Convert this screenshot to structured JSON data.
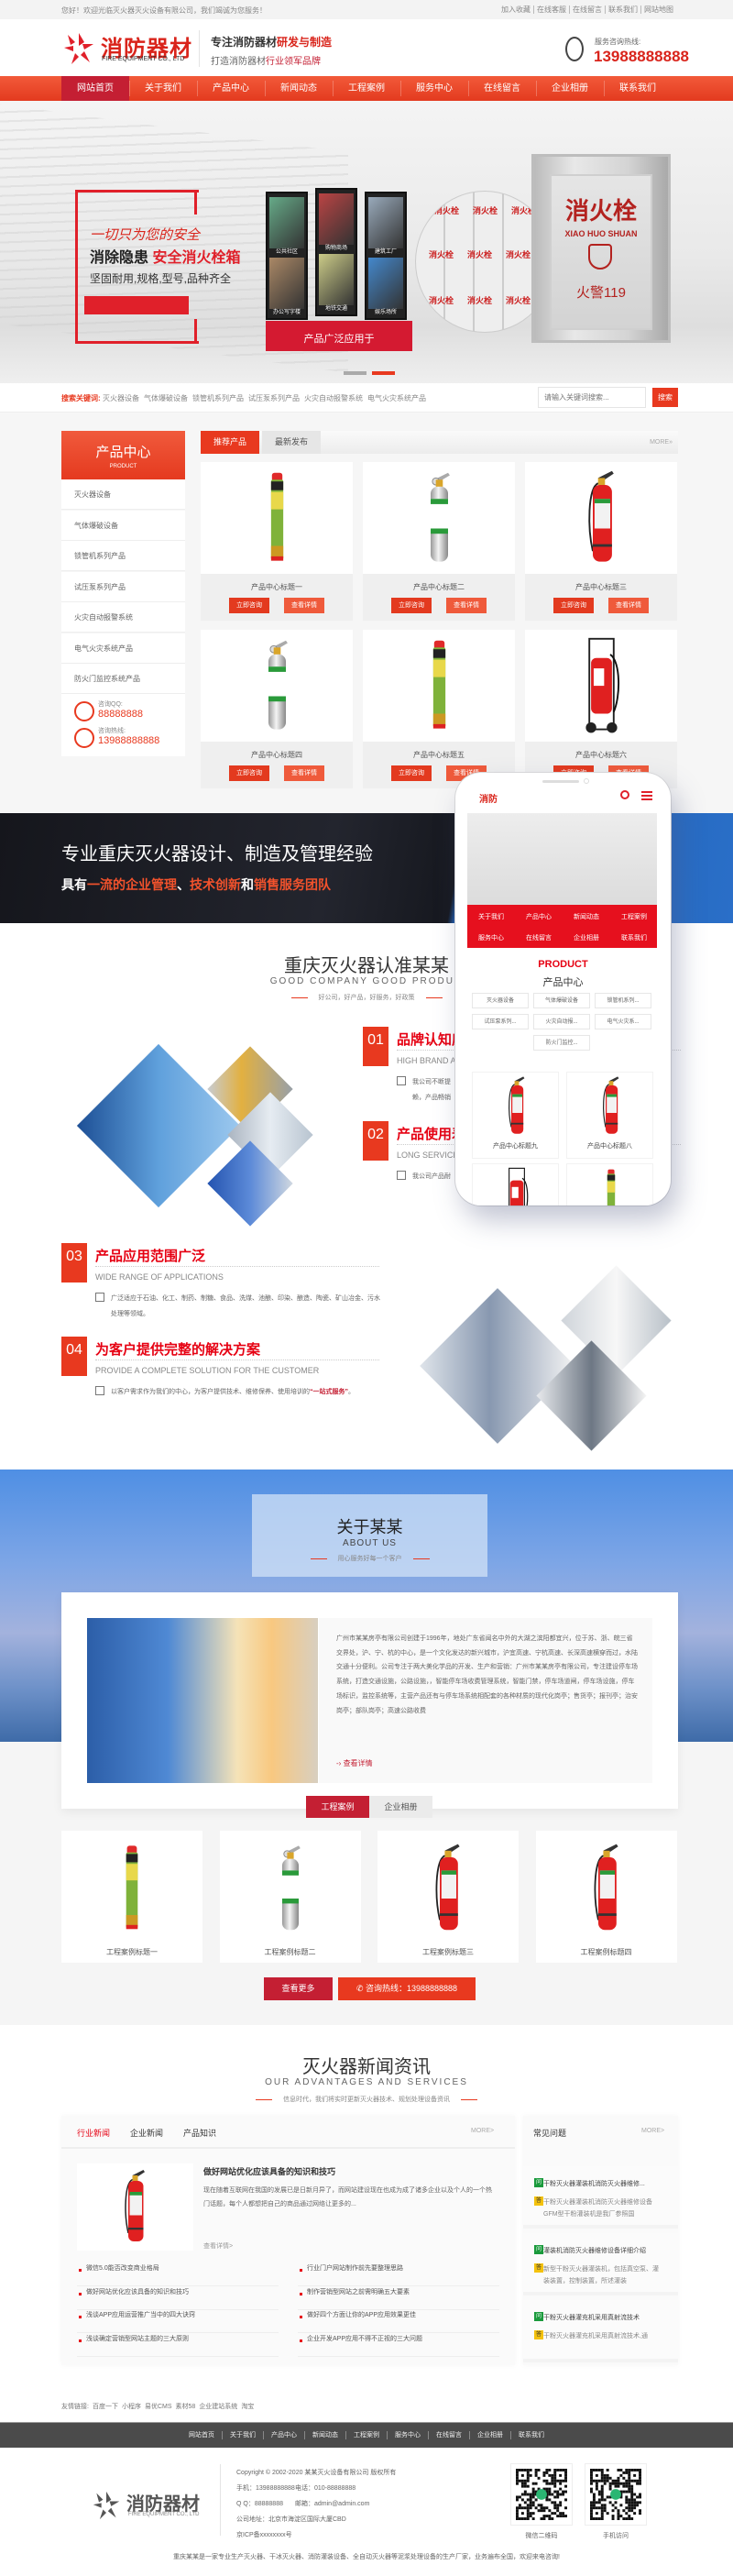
{
  "topbar": {
    "welcome": "您好！欢迎光临灭火器灭火设备有限公司，我们竭诚为您服务！",
    "links": [
      "加入收藏",
      "在线客服",
      "在线留言",
      "联系我们",
      "网站地图"
    ]
  },
  "header": {
    "logo_cn": "消防器材",
    "logo_en": "FIRE EQUIPMENT CO., LTD",
    "slogan_a": "专注消防器材",
    "slogan_b": "研发与制造",
    "tag_a": "打造消防器材",
    "tag_b": "行业领军品牌",
    "hotline_label": "服务咨询热线:",
    "hotline": "13988888888"
  },
  "nav": {
    "items": [
      "网站首页",
      "关于我们",
      "产品中心",
      "新闻动态",
      "工程案例",
      "服务中心",
      "在线留言",
      "企业相册",
      "联系我们"
    ],
    "active": 0
  },
  "hero": {
    "script": "一切只为您的安全",
    "line1a": "消除隐患",
    "line1b": "安全消火栓箱",
    "line2": "坚固耐用,规格,型号,品种齐全",
    "apply": "产品广泛应用于",
    "scenes": [
      "公共社区",
      "购物商场",
      "建筑工厂",
      "办公写字楼",
      "地铁交通",
      "娱乐场所"
    ],
    "box_cn": "消火栓",
    "box_en": "XIAO HUO SHUAN",
    "box_119": "火警119",
    "slides": 2,
    "active_slide": 1
  },
  "search": {
    "label": "搜索关键词:",
    "keywords": [
      "灭火器设备",
      "气体爆破设备",
      "锁管机系列产品",
      "试压泵系列产品",
      "火灾自动报警系统",
      "电气火灾系统产品"
    ],
    "placeholder": "请输入关键词搜索...",
    "button": "搜索"
  },
  "products": {
    "sidebar": {
      "title": "产品中心",
      "subtitle": "PRODUCT",
      "categories": [
        "灭火器设备",
        "气体爆破设备",
        "锁管机系列产品",
        "试压泵系列产品",
        "火灾自动报警系统",
        "电气火灾系统产品",
        "防火门监控系统产品"
      ],
      "qq_label": "咨询QQ:",
      "qq": "88888888",
      "tel_label": "咨询热线:",
      "tel": "13988888888"
    },
    "tabs": [
      "推荐产品",
      "最新发布"
    ],
    "active_tab": 0,
    "more": "MORE»",
    "consult": "立即咨询",
    "detail": "查看详情",
    "items": [
      {
        "title": "产品中心标题一",
        "image": "spray-can"
      },
      {
        "title": "产品中心标题二",
        "image": "silver-extinguisher"
      },
      {
        "title": "产品中心标题三",
        "image": "red-extinguisher"
      },
      {
        "title": "产品中心标题四",
        "image": "silver-extinguisher"
      },
      {
        "title": "产品中心标题五",
        "image": "spray-can"
      },
      {
        "title": "产品中心标题六",
        "image": "cart-extinguisher"
      }
    ]
  },
  "banner": {
    "title": "专业重庆灭火器设计、制造及管理经验",
    "sub": [
      {
        "text": "具有",
        "highlight": false
      },
      {
        "text": "一流的企业管理",
        "highlight": true
      },
      {
        "text": "、",
        "highlight": false
      },
      {
        "text": "技术创新",
        "highlight": true
      },
      {
        "text": "和",
        "highlight": false
      },
      {
        "text": "销售服务团队",
        "highlight": true
      }
    ]
  },
  "advantages": {
    "title": "重庆灭火器认准某某",
    "en": "GOOD COMPANY GOOD PRODUC",
    "sub": "好公司，好产品，好服务，好政策",
    "items": [
      {
        "num": "01",
        "title": "品牌认知度",
        "en": "HIGH BRAND A",
        "text": "我公司不断提",
        "text2": "赖，产品畅销"
      },
      {
        "num": "02",
        "title": "产品使用寿",
        "en": "LONG SERVICE",
        "text": "我公司产品耐"
      },
      {
        "num": "03",
        "title": "产品应用范围广泛",
        "en": "WIDE RANGE OF APPLICATIONS",
        "text": "广泛适应于石油、化工、制药、制糖、食品、洗煤、池酿、印染、酿造、陶瓷、矿山冶金、污水处理等领域。"
      },
      {
        "num": "04",
        "title": "为客户提供完整的解决方案",
        "en": "PROVIDE A COMPLETE SOLUTION FOR THE CUSTOMER",
        "text": "以客户需求作为我们的中心，为客户提供技术、维修保养、使用培训的",
        "highlight": "“一站式服务”",
        "tail": "。"
      }
    ]
  },
  "phone": {
    "logo": "消防",
    "nav": [
      "关于我们",
      "产品中心",
      "新闻动态",
      "工程案例",
      "服务中心",
      "在线留言",
      "企业相册",
      "联系我们"
    ],
    "product_en": "PRODUCT",
    "product_cn": "产品中心",
    "chips": [
      "灭火器设备",
      "气体爆破设备",
      "锁管机系列...",
      "试压泵系列...",
      "火灾自动报...",
      "电气火灾系...",
      "防火门监控..."
    ],
    "items": [
      "产品中心标题九",
      "产品中心标题八"
    ]
  },
  "about": {
    "title": "关于某某",
    "en": "ABOUT US",
    "sub": "用心服务好每一个客户",
    "text": "广州市某某房亭有限公司创建于1996年，地处广东省闻名中外的大湖之滨阳都宜兴，位于苏、浙、皖三省交界处，沪、宁、杭的中心，是一个文化发达的新兴城市，沪宜高速、宁杭高速、长深高速横穿而过，水陆交通十分便利。公司专注于两大美化学品的开发、生产和营销：广州市某某房亭有限公司，专注建设停车场系统，打造交通设施，公路设施，，智能停车场收费管理系统，智能门禁，停车场道闸，停车场设施，停车场标识，监控系统等，主营产品还有与停车场系统相配套的各种材质的现代化岗亭；售货亭；报刊亭；治安岗亭；部队岗亭；高速公路收费",
    "more": "查看详情"
  },
  "cases": {
    "tabs": [
      "工程案例",
      "企业相册"
    ],
    "active_tab": 0,
    "items": [
      {
        "title": "工程案例标题一",
        "image": "spray-can"
      },
      {
        "title": "工程案例标题二",
        "image": "silver-extinguisher"
      },
      {
        "title": "工程案例标题三",
        "image": "red-extinguisher"
      },
      {
        "title": "工程案例标题四",
        "image": "red-extinguisher"
      }
    ],
    "more": "查看更多",
    "hotline": "咨询热线：13988888888"
  },
  "news": {
    "title": "灭火器新闻资讯",
    "en": "OUR ADVANTAGES AND SERVICES",
    "sub": "信息时代，我们将实时更新灭火器技术、规划处理设备资讯",
    "tabs": [
      "行业新闻",
      "企业新闻",
      "产品知识"
    ],
    "active_tab": 0,
    "more": "MORE>",
    "featured": {
      "title": "做好网站优化应该具备的知识和技巧",
      "desc": "现在随着互联网在我国的发展已是日新月异了，而网站建设现在也成为成了诸多企业以及个人的一个热门话题，每个人都想把自己的商品通过网络让更多的...",
      "more": "查看详情>"
    },
    "list_left": [
      "微信5.0能否改变商业格局",
      "做好网站优化应该具备的知识和技巧",
      "浅谈APP应用运营推广当中的四大诀窍",
      "浅谈确定营销型网站主题的三大原则"
    ],
    "list_right": [
      "行业门户网站制作前先要整理思路",
      "制作营销型网站之前需明确五大要素",
      "做好四个方面让你的APP应用效果更佳",
      "企业开发APP应用不得不正视的三大问题"
    ],
    "faq": {
      "title": "常见问题",
      "more": "MORE>",
      "q_icon": "问",
      "a_icon": "答",
      "items": [
        {
          "q": "干粉灭火器灌装机消防灭火器维修...",
          "a": "干粉灭火器灌装机消防灭火器维修设备 GFM型干粉灌装机是我厂参照国"
        },
        {
          "q": "灌装机消防灭火器维修设备详细介绍",
          "a": "新型干粉灭火器灌装机，包括真空泵、灌装装置，控制装置，所述灌装"
        },
        {
          "q": "干粉灭火器灌充机采用真射流技术",
          "a": "干粉灭火器灌充机采用真射流技术,通"
        }
      ]
    }
  },
  "friend_links": {
    "label": "友情链接:",
    "links": [
      "百度一下",
      "小程序",
      "易优CMS",
      "素材58",
      "企业建站系统",
      "淘宝"
    ]
  },
  "footer": {
    "nav": [
      "网站首页",
      "关于我们",
      "产品中心",
      "新闻动态",
      "工程案例",
      "服务中心",
      "在线留言",
      "企业相册",
      "联系我们"
    ],
    "logo_cn": "消防器材",
    "logo_en": "FIRE EQUIPMENT CO., LTD",
    "copyright": "Copyright © 2002-2020 某某灭火设备有限公司 版权所有",
    "mobile": "手机：13988888888",
    "phone": "电话：010-88888888",
    "qq": "Q Q：88888888",
    "email": "邮箱：admin@admin.com",
    "address": "公司地址：北京市海淀区国际大厦CBD",
    "icp": "京ICP备xxxxxxxx号",
    "qr_labels": [
      "微信二维码",
      "手机访问"
    ],
    "bottom": "重庆某某是一家专业生产灭火器、干冰灭火器、消防灌装设备、全自动灭火器等泥浆处理设备的生产厂家，业务遍布全国，欢迎来电咨询!"
  },
  "colors": {
    "primary": "#e8391f",
    "dark_red": "#c41f33",
    "title_red": "#e60012",
    "footer_bg": "#4b4b4b"
  }
}
